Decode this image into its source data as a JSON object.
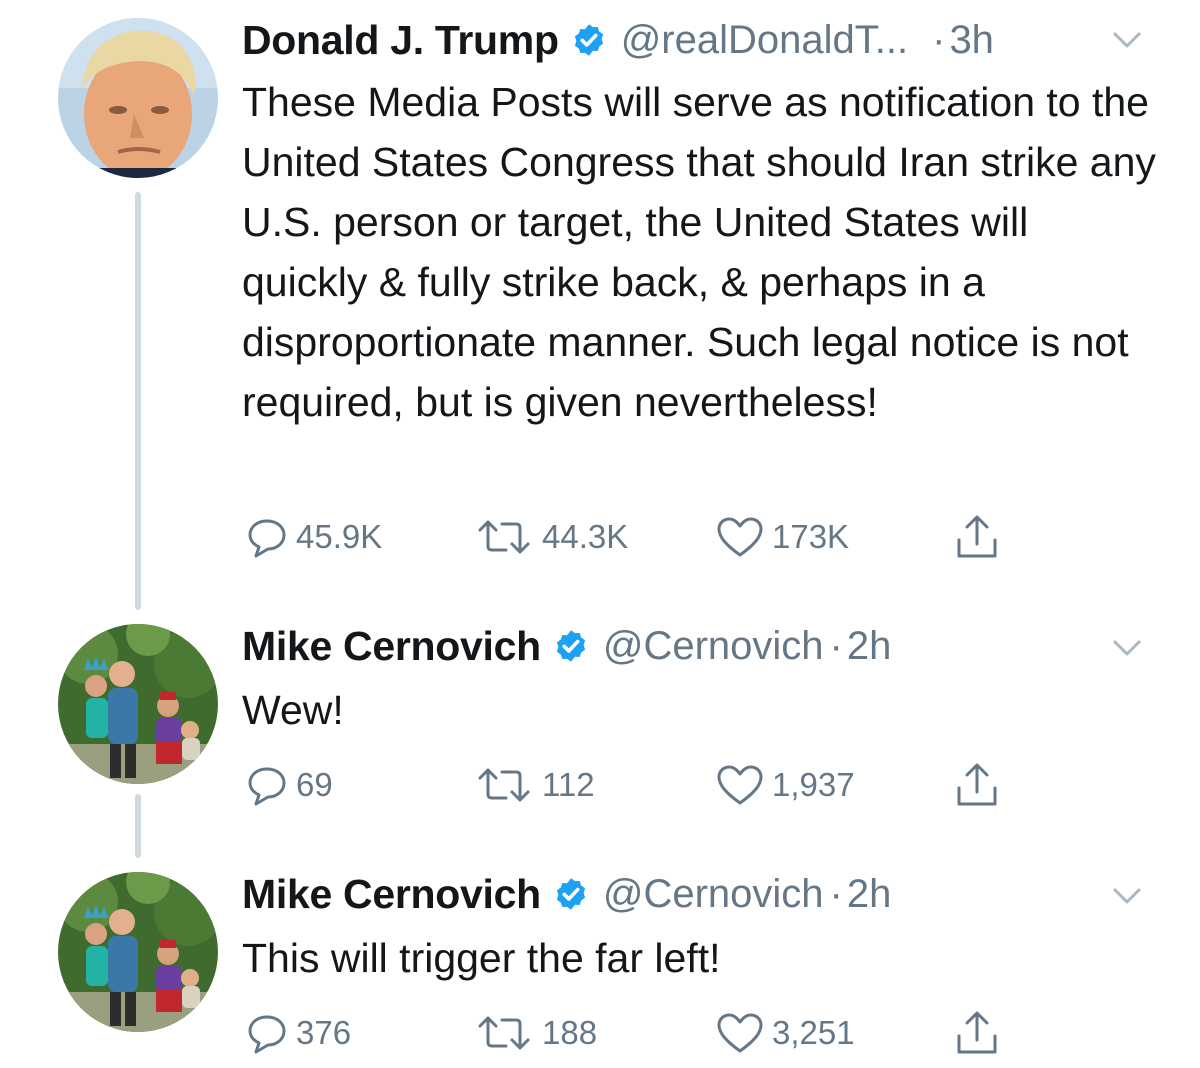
{
  "tweets": [
    {
      "name": "Donald J. Trump",
      "handle": "@realDonaldT...",
      "time_separator": "·",
      "time": "3h",
      "verified": true,
      "text": "These Media Posts will serve as notification to the United States Congress that should Iran strike any U.S. person or target, the United States will quickly & fully strike back, & perhaps in a disproportionate manner. Such legal notice is not required, but is given nevertheless!",
      "replies": "45.9K",
      "retweets": "44.3K",
      "likes": "173K",
      "avatar_icon": "portrait-avatar"
    },
    {
      "name": "Mike Cernovich",
      "handle": "@Cernovich",
      "time_separator": "·",
      "time": "2h",
      "verified": true,
      "text": "Wew!",
      "replies": "69",
      "retweets": "112",
      "likes": "1,937",
      "avatar_icon": "family-photo-avatar"
    },
    {
      "name": "Mike Cernovich",
      "handle": "@Cernovich",
      "time_separator": "·",
      "time": "2h",
      "verified": true,
      "text": "This will trigger the far left!",
      "replies": "376",
      "retweets": "188",
      "likes": "3,251",
      "avatar_icon": "family-photo-avatar"
    }
  ],
  "colors": {
    "text": "#14171a",
    "secondary": "#657786",
    "verified": "#1da1f2",
    "thread_line": "#cfd9de"
  }
}
